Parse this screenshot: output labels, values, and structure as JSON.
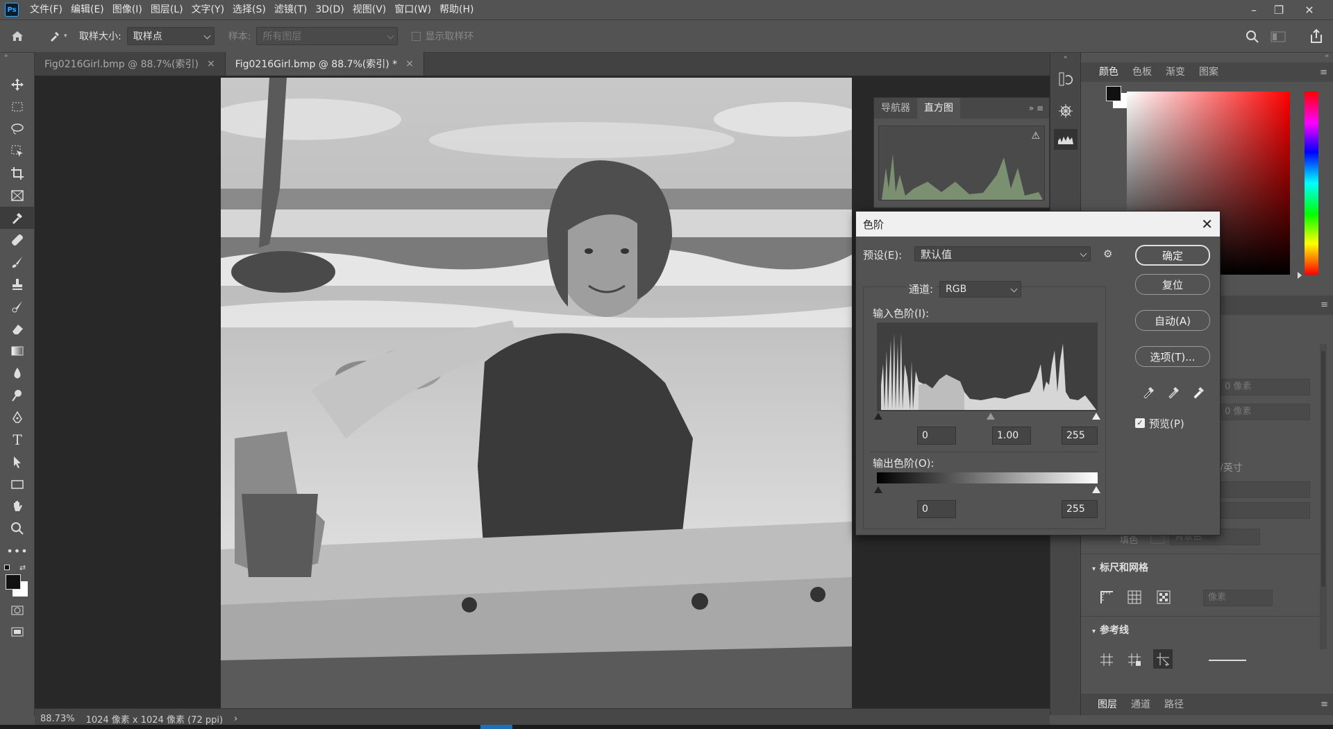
{
  "app": {
    "logo": "Ps"
  },
  "menu": [
    "文件(F)",
    "编辑(E)",
    "图像(I)",
    "图层(L)",
    "文字(Y)",
    "选择(S)",
    "滤镜(T)",
    "3D(D)",
    "视图(V)",
    "窗口(W)",
    "帮助(H)"
  ],
  "options": {
    "sample_size_label": "取样大小:",
    "sample_size_value": "取样点",
    "sample_label": "样本:",
    "sample_value": "所有图层",
    "show_ring_label": "显示取样环"
  },
  "tabs": [
    {
      "label": "Fig0216Girl.bmp @ 88.7%(索引)",
      "close": "×"
    },
    {
      "label": "Fig0216Girl.bmp @ 88.7%(索引) *",
      "close": "×"
    }
  ],
  "status": {
    "zoom": "88.73%",
    "info": "1024 像素 x 1024 像素 (72 ppi)",
    "arrow": "›"
  },
  "histogram_panel": {
    "tabs": [
      "导航器",
      "直方图"
    ],
    "warning": "⚠"
  },
  "color_panel": {
    "tabs": [
      "颜色",
      "色板",
      "渐变",
      "图案"
    ]
  },
  "properties_panel": {
    "unit_pixels_1": "0 像素",
    "unit_pixels_2": "0 像素",
    "resolution_unit": "/英寸",
    "bg_label": "填色",
    "bg_value": "背景色",
    "ruler_section": "标尺和网格",
    "ruler_unit": "像素",
    "guides_section": "参考线"
  },
  "layers_panel": {
    "tabs": [
      "图层",
      "通道",
      "路径"
    ]
  },
  "levels_dialog": {
    "title": "色阶",
    "close": "✕",
    "preset_label": "预设(E):",
    "preset_value": "默认值",
    "channel_label": "通道:",
    "channel_value": "RGB",
    "input_label": "输入色阶(I):",
    "input_black": "0",
    "input_gamma": "1.00",
    "input_white": "255",
    "output_label": "输出色阶(O):",
    "output_black": "0",
    "output_white": "255",
    "btn_ok": "确定",
    "btn_reset": "复位",
    "btn_auto": "自动(A)",
    "btn_options": "选项(T)...",
    "preview_label": "预览(P)",
    "preview_checked": true
  }
}
